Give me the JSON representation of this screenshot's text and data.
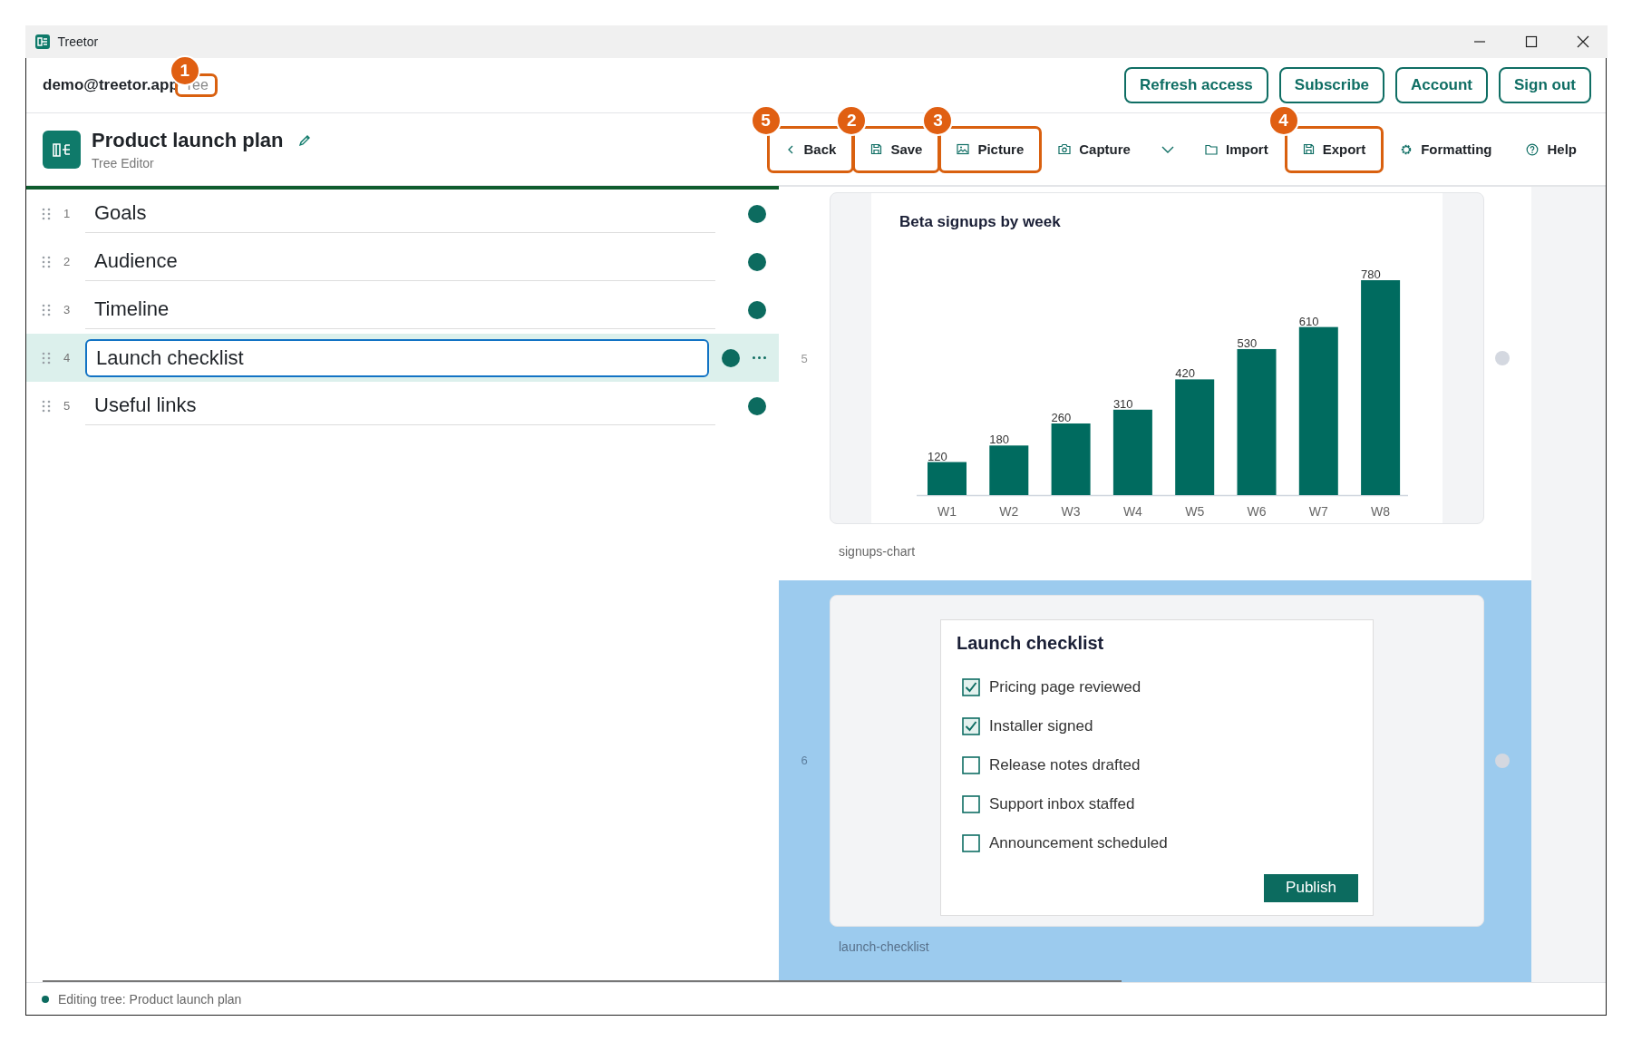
{
  "window": {
    "title": "Treetor"
  },
  "account": {
    "email": "demo@treetor.app",
    "plan": "ree",
    "plan_callout": "1"
  },
  "header_buttons": [
    "Refresh access",
    "Subscribe",
    "Account",
    "Sign out"
  ],
  "document": {
    "title": "Product launch plan",
    "subtitle": "Tree Editor"
  },
  "toolbar": [
    {
      "kind": "back",
      "label": "Back",
      "callout": "5"
    },
    {
      "kind": "save",
      "label": "Save",
      "callout": "2"
    },
    {
      "kind": "picture",
      "label": "Picture",
      "callout": "3"
    },
    {
      "kind": "capture",
      "label": "Capture"
    },
    {
      "kind": "menu"
    },
    {
      "kind": "import",
      "label": "Import"
    },
    {
      "kind": "export",
      "label": "Export",
      "callout": "4"
    },
    {
      "kind": "formatting",
      "label": "Formatting"
    },
    {
      "kind": "help",
      "label": "Help"
    }
  ],
  "tree": [
    {
      "number": "1",
      "title": "Goals",
      "selected": false
    },
    {
      "number": "2",
      "title": "Audience",
      "selected": false
    },
    {
      "number": "3",
      "title": "Timeline",
      "selected": false
    },
    {
      "number": "4",
      "title": "Launch checklist",
      "selected": true
    },
    {
      "number": "5",
      "title": "Useful links",
      "selected": false
    }
  ],
  "preview": [
    {
      "kind": "chart",
      "number": "5",
      "caption": "signups-chart",
      "selected": false,
      "chart_data": {
        "type": "bar",
        "title": "Beta signups by week",
        "categories": [
          "W1",
          "W2",
          "W3",
          "W4",
          "W5",
          "W6",
          "W7",
          "W8"
        ],
        "series": [
          {
            "color": "#006b5f",
            "values": [
              120,
              180,
              260,
              310,
              420,
              530,
              610,
              780
            ]
          }
        ],
        "data_labels": true
      }
    },
    {
      "kind": "checklist",
      "number": "6",
      "caption": "launch-checklist",
      "selected": true,
      "title": "Launch checklist",
      "items": [
        {
          "label": "Pricing page reviewed",
          "checked": true
        },
        {
          "label": "Installer signed",
          "checked": true
        },
        {
          "label": "Release notes drafted",
          "checked": false
        },
        {
          "label": "Support inbox staffed",
          "checked": false
        },
        {
          "label": "Announcement scheduled",
          "checked": false
        }
      ],
      "button": "Publish"
    }
  ],
  "status_bar": {
    "text": "Editing tree: Product launch plan"
  }
}
